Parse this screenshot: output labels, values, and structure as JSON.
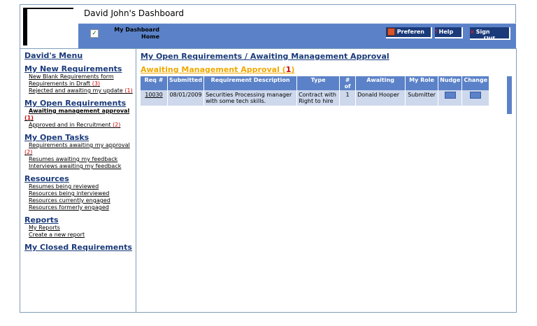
{
  "header": {
    "title": "David John's Dashboard"
  },
  "nav": {
    "home_line1": "My Dashboard",
    "home_line2": "Home",
    "preferences": "Preferen",
    "help": "Help",
    "signout_line1": "Sign",
    "signout_line2": "Out"
  },
  "sidebar": {
    "title": "David's Menu",
    "sections": [
      {
        "heading": "My New Requirements",
        "items": [
          {
            "text": "New Blank Requirements form"
          },
          {
            "text": "Requirements in Draft",
            "count": "(3)"
          },
          {
            "text": "Rejected and awaiting my update",
            "count": "(1)"
          }
        ]
      },
      {
        "heading": "My Open Requirements",
        "items": [
          {
            "text": "Awaiting management approval",
            "count": "(1)",
            "bold": true
          },
          {
            "text": "Approved and in Recruitment",
            "count": "(2)"
          }
        ]
      },
      {
        "heading": "My Open Tasks",
        "items": [
          {
            "text": "Requirements awaiting my approval",
            "count": "(2)"
          },
          {
            "text": "Resumes awaiting my feedback"
          },
          {
            "text": "Interviews awaiting my feedback"
          }
        ]
      },
      {
        "heading": "Resources",
        "items": [
          {
            "text": "Resumes being reviewed"
          },
          {
            "text": "Resources being interviewed"
          },
          {
            "text": "Resources currently engaged"
          },
          {
            "text": "Resources formerly engaged"
          }
        ]
      },
      {
        "heading": "Reports",
        "items": [
          {
            "text": "My Reports"
          },
          {
            "text": "Create a new report"
          }
        ]
      },
      {
        "heading": "My Closed Requirements",
        "items": []
      }
    ]
  },
  "main": {
    "title": "My Open Requirements / Awaiting Management Approval",
    "subtitle": "Awaiting Management Approval",
    "subtitle_count": "1",
    "table": {
      "headers": [
        "Req #",
        "Submitted",
        "Requirement Description",
        "Type",
        "# of",
        "Awaiting",
        "My Role",
        "Nudge",
        "Change"
      ],
      "rows": [
        {
          "req": "10030",
          "submitted": "08/01/2009",
          "description": "Securities Processing manager with some tech skills.",
          "type": "Contract with Right to hire",
          "count": "1",
          "awaiting": "Donald Hooper",
          "role": "Submitter"
        }
      ]
    }
  }
}
